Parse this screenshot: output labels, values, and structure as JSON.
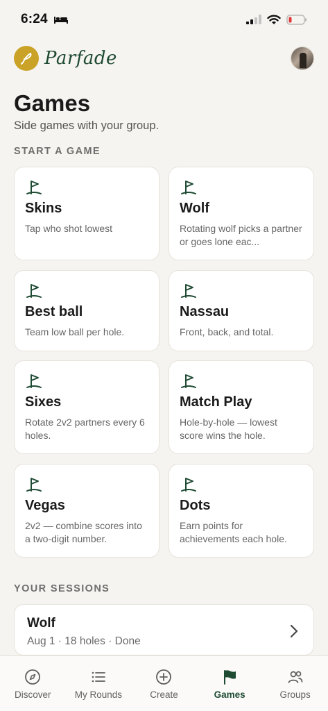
{
  "status_bar": {
    "time": "6:24"
  },
  "header": {
    "brand_name": "Parfade",
    "brand_color": "#c9a227",
    "brand_text_color": "#1f4b33"
  },
  "page": {
    "title": "Games",
    "subtitle": "Side games with your group."
  },
  "start_section": {
    "label": "START A GAME",
    "games": [
      {
        "name": "Skins",
        "description": "Tap who shot lowest",
        "icon": "golf-flag-icon"
      },
      {
        "name": "Wolf",
        "description": "Rotating wolf picks a partner or goes lone eac...",
        "icon": "golf-flag-icon"
      },
      {
        "name": "Best ball",
        "description": "Team low ball per hole.",
        "icon": "golf-flag-icon"
      },
      {
        "name": "Nassau",
        "description": "Front, back, and total.",
        "icon": "golf-flag-icon"
      },
      {
        "name": "Sixes",
        "description": "Rotate 2v2 partners every 6 holes.",
        "icon": "golf-flag-icon"
      },
      {
        "name": "Match Play",
        "description": "Hole-by-hole — lowest score wins the hole.",
        "icon": "golf-flag-icon"
      },
      {
        "name": "Vegas",
        "description": "2v2 — combine scores into a two-digit number.",
        "icon": "golf-flag-icon"
      },
      {
        "name": "Dots",
        "description": "Earn points for achievements each hole.",
        "icon": "golf-flag-icon"
      }
    ]
  },
  "sessions_section": {
    "label": "YOUR SESSIONS",
    "sessions": [
      {
        "title": "Wolf",
        "meta": "Aug 1 · 18 holes · Done"
      }
    ]
  },
  "tab_bar": {
    "active_color": "#1f4b33",
    "tabs": [
      {
        "label": "Discover",
        "icon": "compass-icon",
        "active": false
      },
      {
        "label": "My Rounds",
        "icon": "list-icon",
        "active": false
      },
      {
        "label": "Create",
        "icon": "plus-circle-icon",
        "active": false
      },
      {
        "label": "Games",
        "icon": "flag-icon",
        "active": true
      },
      {
        "label": "Groups",
        "icon": "people-icon",
        "active": false
      }
    ]
  }
}
